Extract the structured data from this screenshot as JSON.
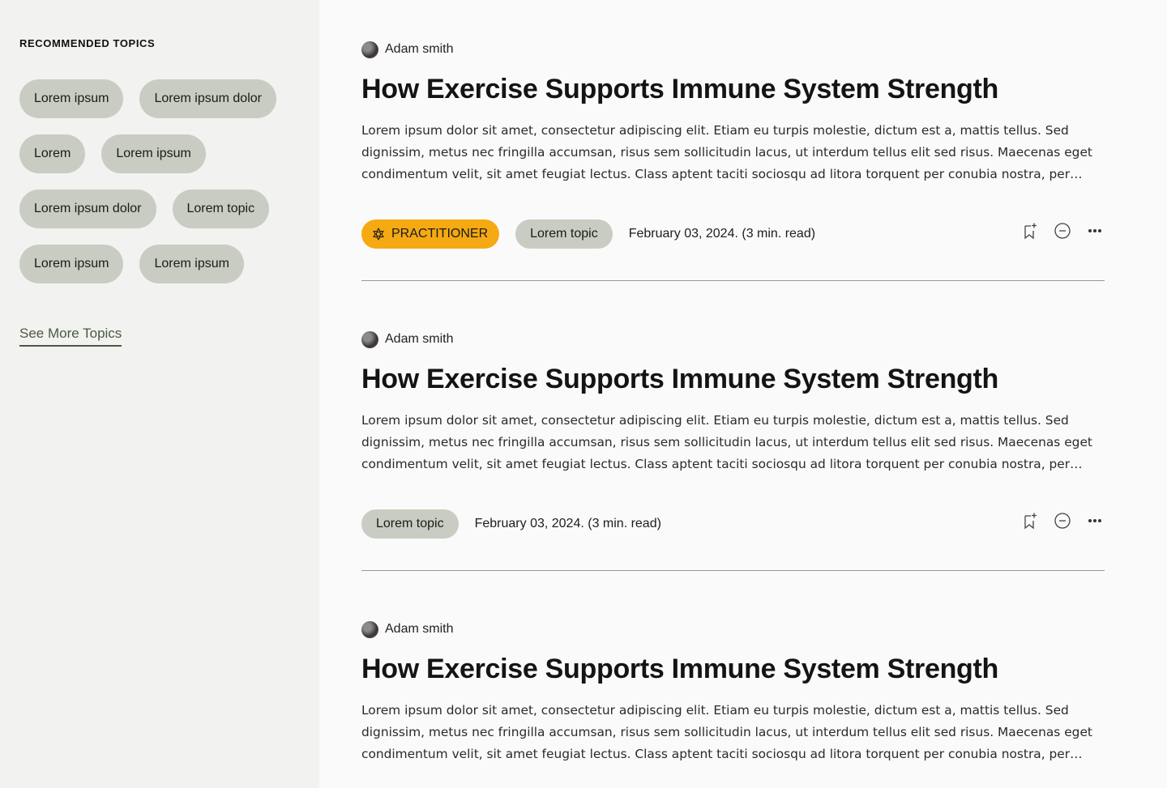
{
  "sidebar": {
    "title": "RECOMMENDED TOPICS",
    "topics": [
      "Lorem ipsum",
      "Lorem ipsum dolor",
      "Lorem",
      "Lorem ipsum",
      "Lorem ipsum dolor",
      "Lorem topic",
      "Lorem ipsum",
      "Lorem ipsum"
    ],
    "see_more": "See More Topics"
  },
  "posts": [
    {
      "author": "Adam smith",
      "title": "How Exercise Supports Immune System Strength",
      "excerpt": "Lorem ipsum dolor sit amet, consectetur adipiscing elit. Etiam eu turpis molestie, dictum est a, mattis tellus. Sed dignissim, metus nec fringilla accumsan, risus sem sollicitudin lacus, ut interdum tellus elit sed risus. Maecenas eget condimentum velit, sit amet feugiat lectus. Class aptent taciti sociosqu ad litora torquent per conubia nostra, per inceptos himenaeos.",
      "badge": "PRACTITIONER",
      "topic": "Lorem topic",
      "date": "February 03, 2024. (3 min. read)"
    },
    {
      "author": "Adam smith",
      "title": "How Exercise Supports Immune System Strength",
      "excerpt": "Lorem ipsum dolor sit amet, consectetur adipiscing elit. Etiam eu turpis molestie, dictum est a, mattis tellus. Sed dignissim, metus nec fringilla accumsan, risus sem sollicitudin lacus, ut interdum tellus elit sed risus. Maecenas eget condimentum velit, sit amet feugiat lectus. Class aptent taciti sociosqu ad litora torquent per conubia nostra, per inceptos himenaeos.",
      "topic": "Lorem topic",
      "date": "February 03, 2024. (3 min. read)"
    },
    {
      "author": "Adam smith",
      "title": "How Exercise Supports Immune System Strength",
      "excerpt": "Lorem ipsum dolor sit amet, consectetur adipiscing elit. Etiam eu turpis molestie, dictum est a, mattis tellus. Sed dignissim, metus nec fringilla accumsan, risus sem sollicitudin lacus, ut interdum tellus elit sed risus. Maecenas eget condimentum velit, sit amet feugiat lectus. Class aptent taciti sociosqu ad litora torquent per conubia nostra, per inceptos himenaeos."
    }
  ],
  "icons": {
    "bookmark": "bookmark-add-icon",
    "hide": "minus-circle-icon",
    "more": "more-horizontal-icon",
    "practitioner": "practitioner-icon"
  },
  "colors": {
    "practitioner_badge": "#f5a912",
    "topic_chip": "#c8ccc2",
    "link": "#4a5a3e",
    "sidebar_bg": "#f2f2f0"
  }
}
